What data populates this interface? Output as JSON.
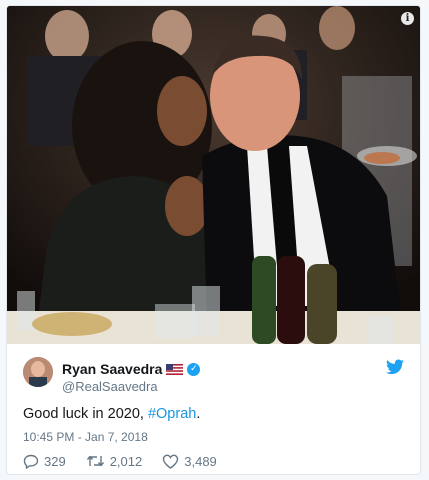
{
  "tweet": {
    "author_name": "Ryan Saavedra",
    "handle": "@RealSaavedra",
    "text_prefix": "Good luck in 2020, ",
    "hashtag": "#Oprah",
    "text_suffix": ".",
    "timestamp": "10:45 PM - Jan 7, 2018",
    "replies": "329",
    "retweets": "2,012",
    "likes": "3,489",
    "verified": true,
    "flag": "us-flag"
  },
  "icons": {
    "info": "info-icon",
    "platform": "twitter-bird-icon",
    "reply": "reply-icon",
    "retweet": "retweet-icon",
    "like": "heart-icon",
    "verified": "verified-check-icon"
  },
  "colors": {
    "brand_blue": "#1da1f2",
    "hashtag": "#1b95e0",
    "muted": "#657786",
    "text": "#14171a"
  }
}
